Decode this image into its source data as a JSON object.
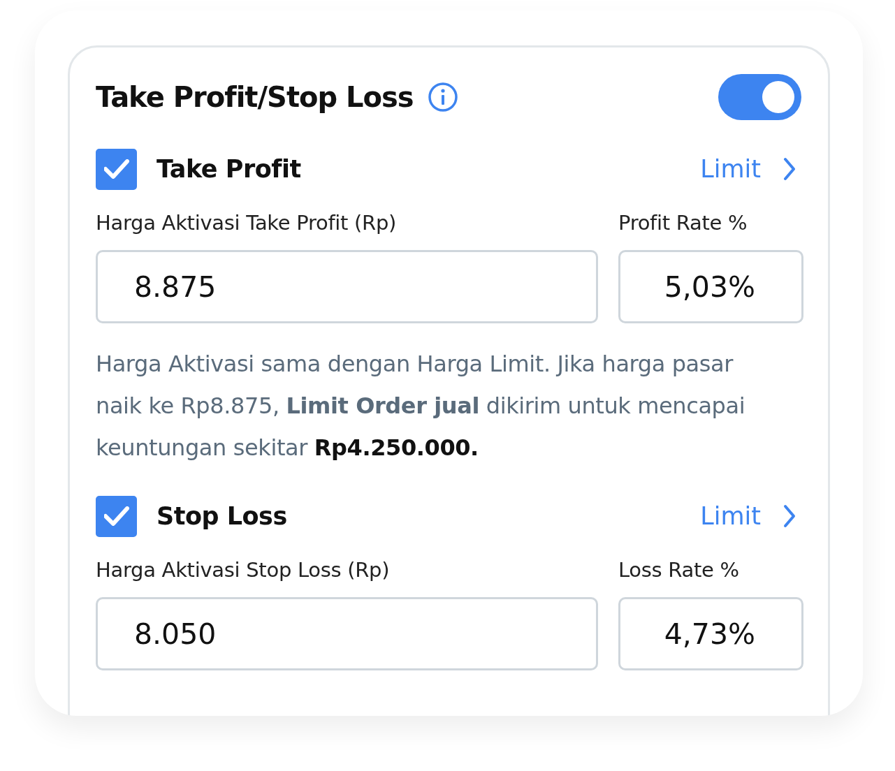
{
  "header": {
    "title": "Take Profit/Stop Loss",
    "toggle_on": true
  },
  "sections": [
    {
      "title": "Take Profit",
      "checked": true,
      "order_type": "Limit",
      "price_label": "Harga Aktivasi Take Profit (Rp)",
      "rate_label": "Profit Rate %",
      "price_value": "8.875",
      "rate_value": "5,03%",
      "note": [
        {
          "kind": "plain",
          "text": "Harga Aktivasi sama dengan Harga Limit. Jika harga pasar naik ke Rp8.875, "
        },
        {
          "kind": "emphasis",
          "text": "Limit Order jual"
        },
        {
          "kind": "plain",
          "text": " dikirim untuk mencapai keuntungan sekitar "
        },
        {
          "kind": "amount",
          "text": "Rp4.250.000."
        }
      ]
    },
    {
      "title": "Stop Loss",
      "checked": true,
      "order_type": "Limit",
      "price_label": "Harga Aktivasi Stop Loss (Rp)",
      "rate_label": "Loss Rate %",
      "price_value": "8.050",
      "rate_value": "4,73%"
    }
  ]
}
